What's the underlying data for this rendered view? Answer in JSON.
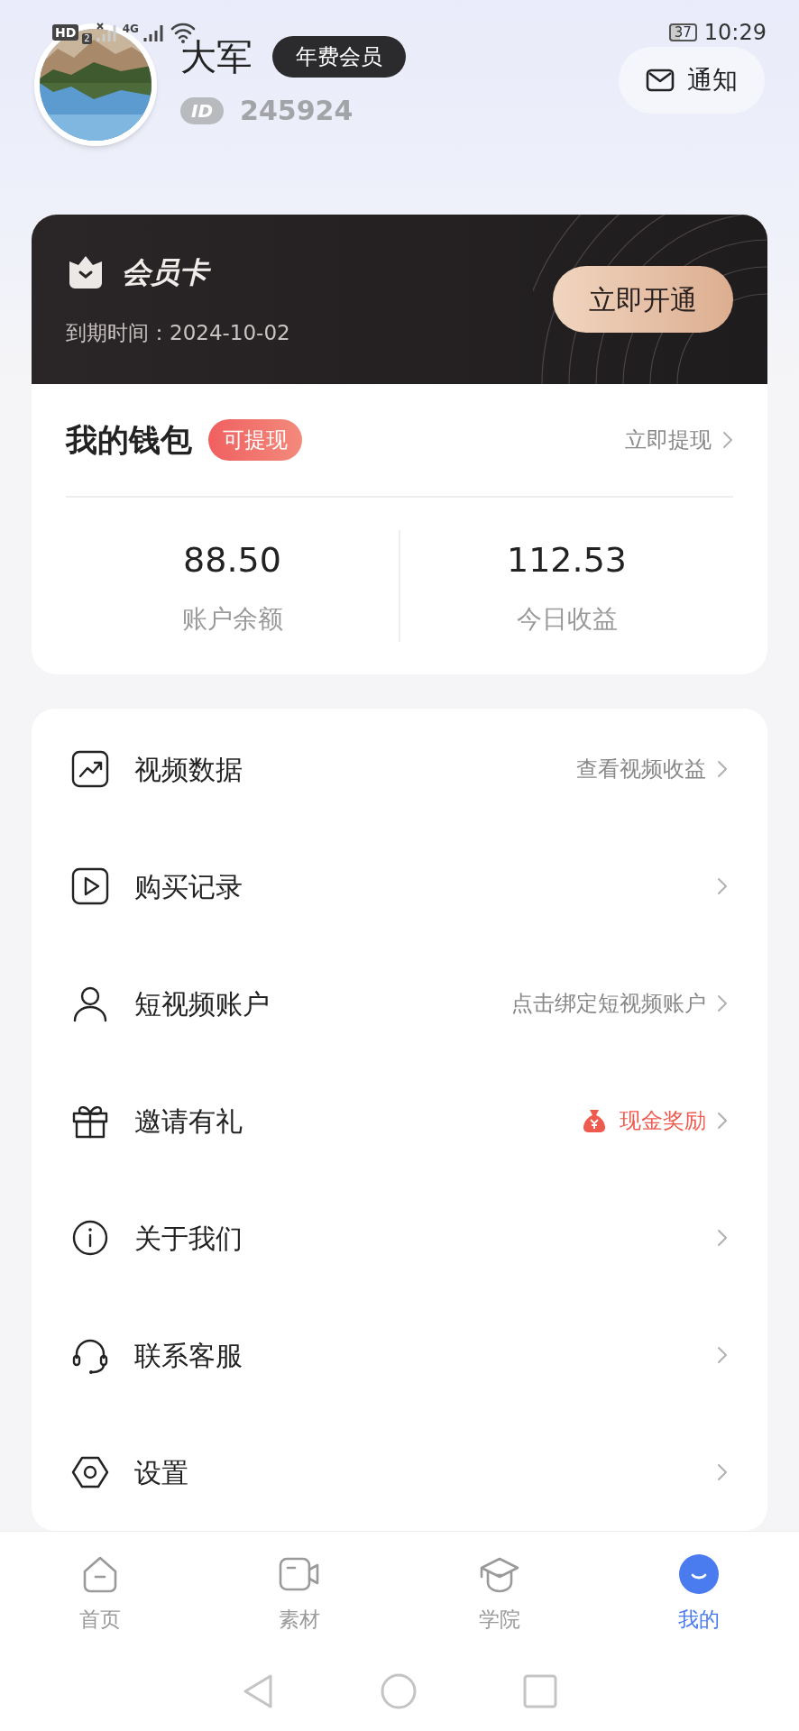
{
  "status_bar": {
    "hd": "HD",
    "sim": "2",
    "network": "4G",
    "battery": "37",
    "time": "10:29"
  },
  "profile": {
    "name": "大军",
    "badge": "年费会员",
    "id_label": "ID",
    "id": "245924"
  },
  "notify_button": {
    "label": "通知"
  },
  "member_card": {
    "title": "会员卡",
    "expiry": "到期时间：2024-10-02",
    "button": "立即开通"
  },
  "wallet": {
    "title": "我的钱包",
    "tag": "可提现",
    "link": "立即提现",
    "stats": [
      {
        "value": "88.50",
        "label": "账户余额"
      },
      {
        "value": "112.53",
        "label": "今日收益"
      }
    ]
  },
  "menu": [
    {
      "label": "视频数据",
      "hint": "查看视频收益",
      "kind": "plain"
    },
    {
      "label": "购买记录",
      "kind": "plain"
    },
    {
      "label": "短视频账户",
      "hint": "点击绑定短视频账户",
      "kind": "plain"
    },
    {
      "label": "邀请有礼",
      "hint": "现金奖励",
      "kind": "reward"
    },
    {
      "label": "关于我们",
      "kind": "plain"
    },
    {
      "label": "联系客服",
      "kind": "plain"
    },
    {
      "label": "设置",
      "kind": "plain"
    }
  ],
  "tabs": [
    {
      "label": "首页",
      "selected": false
    },
    {
      "label": "素材",
      "selected": false
    },
    {
      "label": "学院",
      "selected": false
    },
    {
      "label": "我的",
      "selected": true
    }
  ]
}
